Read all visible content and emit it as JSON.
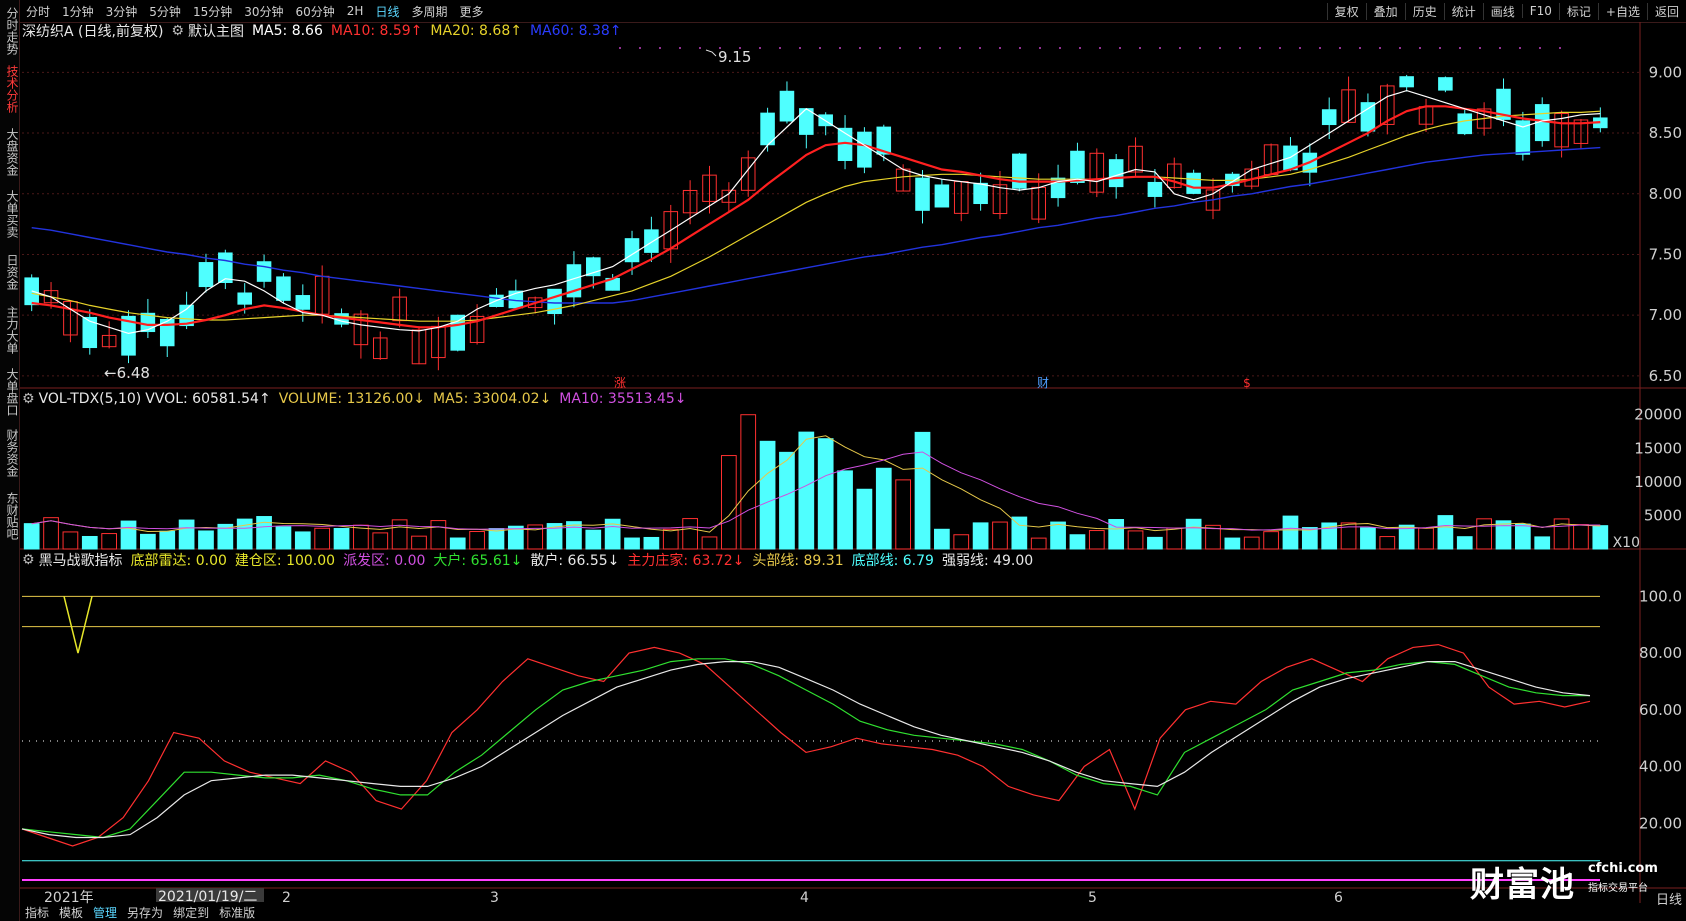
{
  "toolbar": {
    "periods": [
      "分时",
      "1分钟",
      "3分钟",
      "5分钟",
      "15分钟",
      "30分钟",
      "60分钟",
      "2H",
      "日线",
      "多周期",
      "更多"
    ],
    "active_period": "日线",
    "right_items": [
      "复权",
      "叠加",
      "历史",
      "统计",
      "画线",
      "F10",
      "标记",
      "+自选",
      "返回"
    ]
  },
  "left_tabs": [
    {
      "label": "分时走势",
      "active": false
    },
    {
      "label": "技术分析",
      "active": true
    },
    {
      "label": "大盘资金",
      "active": false
    },
    {
      "label": "大单买卖",
      "active": false
    },
    {
      "label": "日资金",
      "active": false
    },
    {
      "label": "主力大单",
      "active": false
    },
    {
      "label": "大单盘口",
      "active": false
    },
    {
      "label": "财务资金",
      "active": false
    },
    {
      "label": "东财贴吧",
      "active": false
    }
  ],
  "price_header": {
    "title": "深纺织A (日线,前复权)",
    "main_chart": "默认主图",
    "ma5": "MA5: 8.66",
    "ma10": "MA10: 8.59↑",
    "ma20": "MA20: 8.68↑",
    "ma60": "MA60: 8.38↑"
  },
  "volume_header": {
    "name": "VOL-TDX(5,10)",
    "vvol": "VVOL: 60581.54↑",
    "volume": "VOLUME: 13126.00↓",
    "ma5": "MA5: 33004.02↓",
    "ma10": "MA10: 35513.45↓"
  },
  "indicator_header": {
    "name": "黑马战歌指标",
    "dblp": "底部雷达: 0.00",
    "jcq": "建仓区: 100.00",
    "pfq": "派发区: 0.00",
    "dh": "大户: 65.61↓",
    "sh": "散户: 66.55↓",
    "zlzj": "主力庄家: 63.72↓",
    "tbx": "头部线: 89.31",
    "dbx": "底部线: 6.79",
    "qrx": "强弱线: 49.00"
  },
  "colors": {
    "up": "#ff3030",
    "down": "#4fffff",
    "ma5": "#ffffff",
    "ma10": "#ff2020",
    "ma20": "#e6d22a",
    "ma60": "#2233dd",
    "vol_ma5": "#e6c84a",
    "vol_ma10": "#d050e0",
    "grid": "#4a1818",
    "accent": "#5bd7ff"
  },
  "chart_data": {
    "type": "candlestick",
    "y_price_ticks": [
      "9.00",
      "8.50",
      "8.00",
      "7.50",
      "7.00",
      "6.50"
    ],
    "y_price_range": [
      6.4,
      9.25
    ],
    "annotations": {
      "high": "9.15",
      "low": "6.48"
    },
    "markers": [
      "涨",
      "财",
      "$"
    ],
    "y_volume_ticks": [
      "20000",
      "15000",
      "10000",
      "5000"
    ],
    "volume_unit": "X10",
    "y_indicator_ticks": [
      "100.0",
      "80.00",
      "60.00",
      "40.00",
      "20.00"
    ],
    "x_labels": [
      "2021年",
      "2",
      "3",
      "4",
      "5",
      "6"
    ],
    "cursor_date": "2021/01/19/二",
    "bottom_right_label": "日线",
    "ma": {
      "ma5": [
        7.2,
        7.15,
        7.05,
        6.95,
        6.9,
        6.85,
        6.88,
        6.95,
        7.05,
        7.2,
        7.3,
        7.28,
        7.2,
        7.1,
        7.02,
        7.0,
        6.95,
        6.92,
        6.9,
        6.88,
        6.87,
        6.9,
        6.95,
        7.05,
        7.12,
        7.18,
        7.22,
        7.25,
        7.3,
        7.35,
        7.4,
        7.5,
        7.6,
        7.7,
        7.8,
        7.9,
        8.0,
        8.2,
        8.4,
        8.55,
        8.7,
        8.6,
        8.5,
        8.4,
        8.3,
        8.2,
        8.15,
        8.12,
        8.1,
        8.08,
        8.05,
        8.03,
        8.05,
        8.1,
        8.12,
        8.1,
        8.15,
        8.2,
        8.18,
        8.0,
        7.95,
        8.0,
        8.1,
        8.2,
        8.25,
        8.3,
        8.4,
        8.5,
        8.6,
        8.7,
        8.8,
        8.85,
        8.8,
        8.75,
        8.7,
        8.65,
        8.6,
        8.55,
        8.6,
        8.62,
        8.65,
        8.66
      ],
      "ma10": [
        7.1,
        7.08,
        7.05,
        7.02,
        6.98,
        6.95,
        6.92,
        6.92,
        6.93,
        6.96,
        7.0,
        7.05,
        7.08,
        7.06,
        7.03,
        7.0,
        6.98,
        6.96,
        6.94,
        6.92,
        6.9,
        6.9,
        6.92,
        6.95,
        7.0,
        7.05,
        7.1,
        7.15,
        7.2,
        7.25,
        7.3,
        7.38,
        7.46,
        7.55,
        7.65,
        7.75,
        7.85,
        7.95,
        8.08,
        8.2,
        8.32,
        8.4,
        8.42,
        8.4,
        8.35,
        8.3,
        8.25,
        8.2,
        8.18,
        8.15,
        8.12,
        8.1,
        8.1,
        8.1,
        8.11,
        8.12,
        8.13,
        8.14,
        8.14,
        8.1,
        8.05,
        8.05,
        8.08,
        8.12,
        8.16,
        8.2,
        8.26,
        8.34,
        8.42,
        8.5,
        8.6,
        8.68,
        8.72,
        8.72,
        8.7,
        8.68,
        8.65,
        8.62,
        8.6,
        8.58,
        8.58,
        8.59
      ],
      "ma20": [
        7.18,
        7.15,
        7.12,
        7.08,
        7.05,
        7.02,
        7.0,
        6.98,
        6.97,
        6.96,
        6.96,
        6.97,
        6.98,
        6.99,
        7.0,
        7.0,
        6.99,
        6.98,
        6.97,
        6.96,
        6.95,
        6.95,
        6.95,
        6.96,
        6.98,
        7.0,
        7.02,
        7.05,
        7.08,
        7.12,
        7.16,
        7.2,
        7.26,
        7.32,
        7.4,
        7.48,
        7.57,
        7.66,
        7.75,
        7.84,
        7.93,
        8.0,
        8.06,
        8.1,
        8.12,
        8.14,
        8.15,
        8.16,
        8.16,
        8.15,
        8.14,
        8.13,
        8.12,
        8.12,
        8.12,
        8.12,
        8.13,
        8.14,
        8.14,
        8.13,
        8.12,
        8.11,
        8.11,
        8.12,
        8.14,
        8.16,
        8.2,
        8.25,
        8.3,
        8.36,
        8.42,
        8.48,
        8.53,
        8.57,
        8.6,
        8.62,
        8.64,
        8.65,
        8.66,
        8.67,
        8.67,
        8.68
      ],
      "ma60": [
        7.72,
        7.7,
        7.67,
        7.64,
        7.61,
        7.58,
        7.55,
        7.52,
        7.5,
        7.47,
        7.45,
        7.42,
        7.4,
        7.37,
        7.35,
        7.32,
        7.3,
        7.28,
        7.26,
        7.24,
        7.22,
        7.2,
        7.18,
        7.16,
        7.14,
        7.12,
        7.11,
        7.1,
        7.1,
        7.1,
        7.1,
        7.12,
        7.15,
        7.18,
        7.21,
        7.24,
        7.27,
        7.3,
        7.33,
        7.36,
        7.39,
        7.42,
        7.45,
        7.48,
        7.5,
        7.53,
        7.56,
        7.58,
        7.61,
        7.64,
        7.66,
        7.69,
        7.72,
        7.74,
        7.77,
        7.8,
        7.82,
        7.85,
        7.88,
        7.9,
        7.93,
        7.95,
        7.98,
        8.0,
        8.03,
        8.06,
        8.08,
        8.11,
        8.14,
        8.17,
        8.2,
        8.23,
        8.26,
        8.28,
        8.3,
        8.32,
        8.33,
        8.34,
        8.35,
        8.36,
        8.37,
        8.38
      ]
    },
    "indicator": {
      "red": [
        18,
        15,
        12,
        15,
        22,
        35,
        52,
        50,
        42,
        38,
        36,
        34,
        42,
        38,
        28,
        25,
        35,
        52,
        60,
        70,
        78,
        75,
        72,
        70,
        80,
        82,
        80,
        76,
        68,
        60,
        52,
        45,
        47,
        50,
        48,
        47,
        46,
        44,
        40,
        33,
        30,
        28,
        40,
        46,
        25,
        50,
        60,
        63,
        62,
        70,
        75,
        78,
        74,
        70,
        78,
        82,
        83,
        80,
        68,
        62,
        63,
        61,
        63
      ],
      "green": [
        18,
        17,
        16,
        15,
        18,
        28,
        38,
        38,
        37,
        36,
        36,
        37,
        35,
        32,
        30,
        30,
        38,
        44,
        52,
        60,
        67,
        70,
        72,
        74,
        77,
        78,
        78,
        76,
        72,
        67,
        62,
        56,
        53,
        51,
        50,
        49,
        48,
        46,
        42,
        37,
        34,
        33,
        30,
        45,
        50,
        55,
        60,
        67,
        70,
        73,
        74,
        76,
        77,
        76,
        72,
        68,
        66,
        65,
        65
      ],
      "white": [
        18,
        16,
        15,
        15,
        16,
        22,
        30,
        35,
        36,
        37,
        37,
        36,
        35,
        34,
        33,
        33,
        36,
        40,
        46,
        52,
        58,
        63,
        68,
        71,
        74,
        76,
        77,
        77,
        75,
        71,
        67,
        62,
        58,
        54,
        51,
        49,
        47,
        45,
        42,
        38,
        35,
        34,
        33,
        38,
        45,
        51,
        57,
        63,
        68,
        71,
        73,
        75,
        77,
        77,
        74,
        71,
        68,
        66,
        65
      ]
    }
  }
}
